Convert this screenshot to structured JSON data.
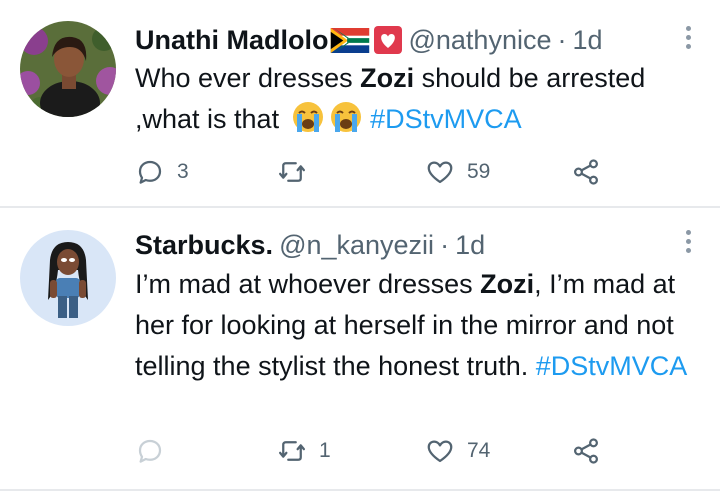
{
  "tweets": [
    {
      "name": "Unathi Madlolo",
      "handle": "@nathynice",
      "dot": "·",
      "time": "1d",
      "text_pre": "Who ever dresses ",
      "text_bold": "Zozi",
      "text_post": " should be arrested ,what is that ",
      "hashtag": "#DStvMVCA",
      "emojis": [
        "south-africa-flag",
        "white-heart-red-square",
        "loudly-crying-face",
        "loudly-crying-face"
      ],
      "replies": "3",
      "retweets": "",
      "likes": "59"
    },
    {
      "name": "Starbucks.",
      "handle": "@n_kanyezii",
      "dot": "·",
      "time": "1d",
      "text_pre": "I’m mad at whoever dresses ",
      "text_bold": "Zozi",
      "text_post": ", I’m mad at her for looking at herself in the mirror and not telling the stylist the honest truth. ",
      "hashtag": "#DStvMVCA",
      "replies": "",
      "retweets": "1",
      "likes": "74"
    }
  ],
  "colors": {
    "text": "#0f1419",
    "muted": "#536471",
    "link": "#1d9bf0",
    "divider": "#e7e9ec",
    "reply_disabled": "#c8d0d6"
  },
  "icons": [
    "reply-icon",
    "retweet-icon",
    "like-icon",
    "share-icon",
    "more-options-icon"
  ]
}
